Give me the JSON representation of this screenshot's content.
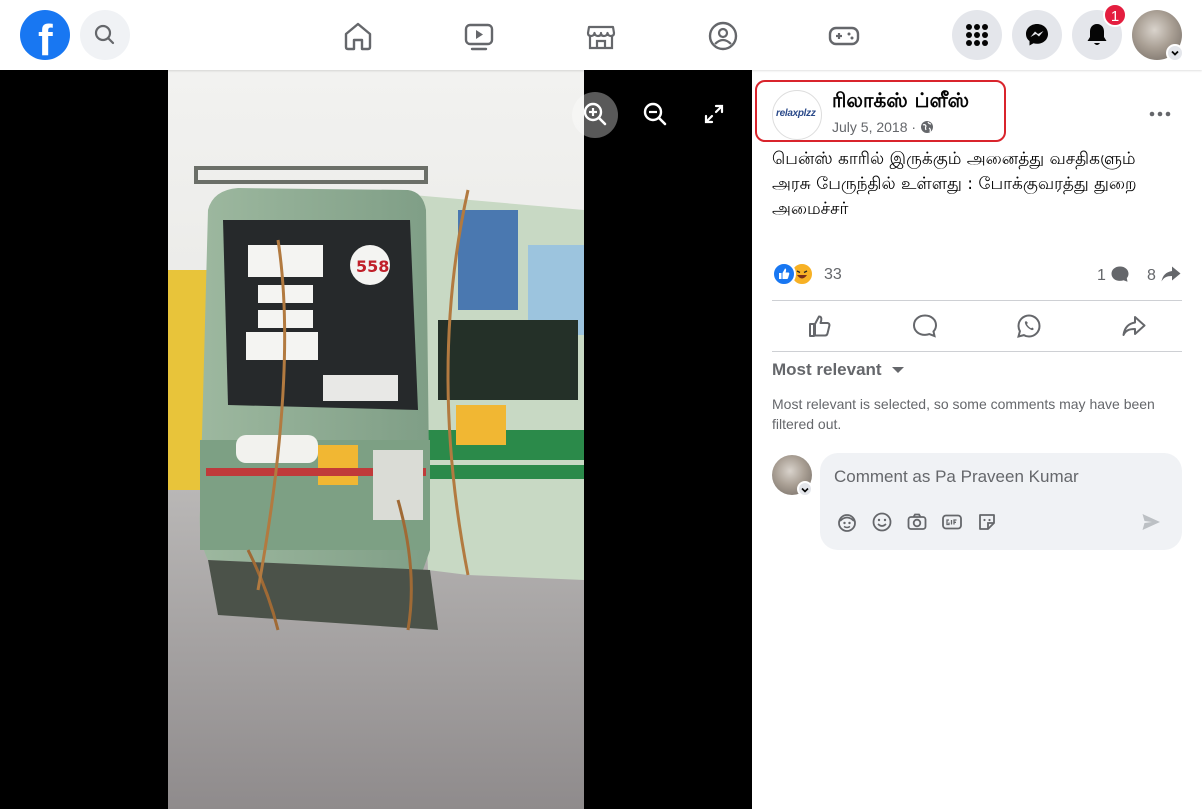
{
  "topbar": {
    "logo_letter": "f",
    "notification_count": "1"
  },
  "icons": {
    "logo": "facebook-logo-icon",
    "search": "search-icon",
    "home": "home-icon",
    "watch": "video-icon",
    "marketplace": "marketplace-icon",
    "groups": "groups-icon",
    "gaming": "gaming-icon",
    "menu": "grid-menu-icon",
    "messenger": "messenger-icon",
    "notifications": "bell-icon",
    "zoom_in": "zoom-in-icon",
    "zoom_out": "zoom-out-icon",
    "fullscreen": "fullscreen-icon"
  },
  "post": {
    "page_name": "ரிலாக்ஸ் ப்ளீஸ்",
    "page_logo_text": "relaxplzz",
    "date": "July 5, 2018 · ",
    "text": "பென்ஸ் காரில் இருக்கும் அனைத்து வசதிகளும் அரசு பேருந்தில் உள்ளது : போக்குவரத்து துறை அமைச்சர்",
    "reaction_count": "33",
    "comment_count": "1",
    "share_count": "8"
  },
  "comments": {
    "sort_label": "Most relevant",
    "sort_note": "Most relevant is selected, so some comments may have been filtered out.",
    "input_placeholder": "Comment as Pa Praveen Kumar"
  },
  "colors": {
    "brand": "#1877f2",
    "badge": "#e41e3f",
    "highlight": "#d9242c"
  }
}
